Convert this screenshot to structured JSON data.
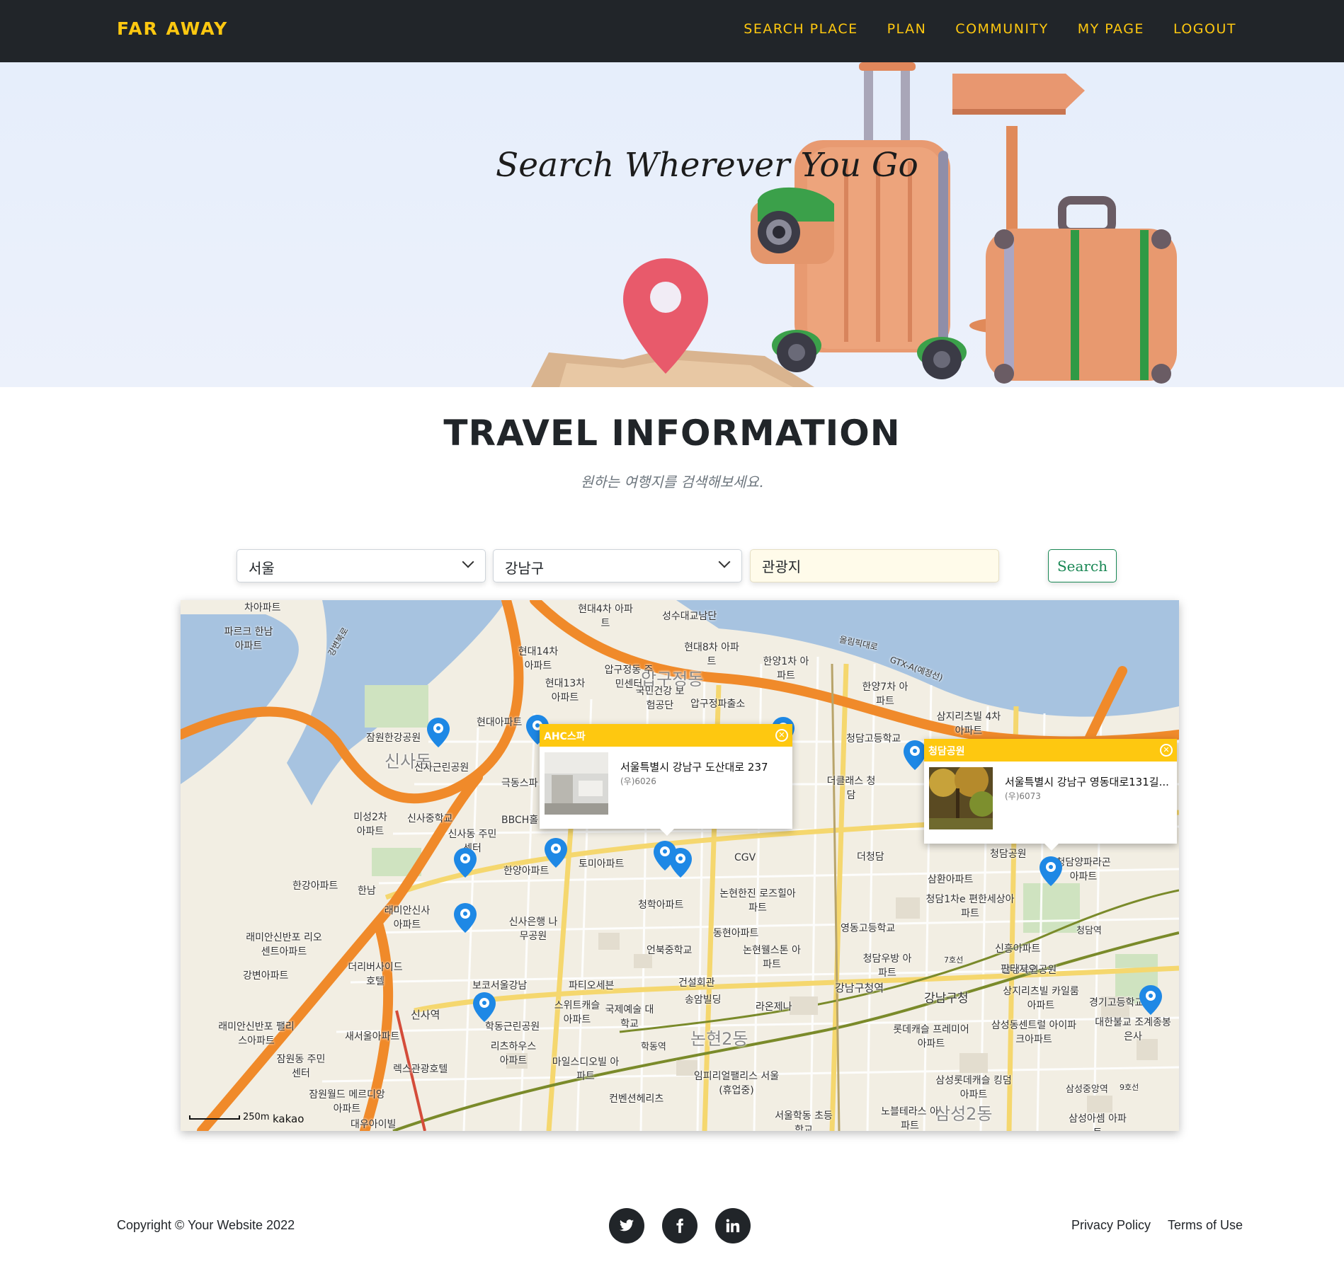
{
  "navbar": {
    "brand": "FAR AWAY",
    "links": [
      "SEARCH PLACE",
      "PLAN",
      "COMMUNITY",
      "MY PAGE",
      "LOGOUT"
    ]
  },
  "hero": {
    "title": "Search Wherever You Go"
  },
  "section": {
    "title": "TRAVEL INFORMATION",
    "subtitle": "원하는 여행지를 검색해보세요."
  },
  "search": {
    "city": "서울",
    "district": "강남구",
    "keyword": "관광지",
    "button": "Search"
  },
  "map": {
    "labels": [
      "압구정동",
      "신사동",
      "논현2동",
      "삼성2동",
      "청담공원",
      "신사역",
      "강남구청역",
      "강남구청",
      "CGV",
      "청담고등학교",
      "영동고등학교",
      "학동근린공원",
      "신사근린공원",
      "잠원한강공원",
      "한강아파트",
      "현대아파트",
      "삼성목련공원",
      "청담역",
      "삼성중앙역",
      "학동역",
      "건설회관",
      "라온제나",
      "동현아파트",
      "토미아파트",
      "한양아파트",
      "청학아파트",
      "극동스파",
      "BBCH홀",
      "현대14차 아파트",
      "현대13차 아파트",
      "압구정동 주민센터",
      "국민건강 보험공단",
      "압구정파출소",
      "한양1차 아파트",
      "한양7차 아파트",
      "삼지리츠빌 4차아파트",
      "더클래스 청담",
      "더청담",
      "삼환아파트",
      "청담1차e 편한세상아파트",
      "신흥아파트",
      "판타지오",
      "상지리츠빌 카일룸아파트",
      "경기고등학교",
      "대한불교 조계종봉은사",
      "삼성동센트럴 아이파크아파트",
      "롯데캐슬 프레미어아파트",
      "삼성롯데캐슬 킹덤아파트",
      "노블테라스 아파트",
      "삼성아셈 아파트",
      "임피리얼팰리스 서울(휴업중)",
      "컨벤션헤리츠",
      "서울학동 초등학교",
      "마일스디오빌 아파트",
      "국제예술 대학교",
      "스위트캐슬 아파트",
      "파티오세븐",
      "보코서울강남",
      "리츠하우스 아파트",
      "렉스관광호텔",
      "잠원동 주민센터",
      "잠원월드 메르디앙아파트",
      "대우아이빌",
      "새서울아파트",
      "래미안신반포 팰리스아파트",
      "강변아파트",
      "더리버사이드 호텔",
      "래미안신반포 리오센트아파트",
      "래미안신사 아파트",
      "미성2차 아파트",
      "신사중학교",
      "신사동 주민센터",
      "신사은행 나무공원",
      "한남",
      "논현한진 로즈힐아파트",
      "논현웰스톤 아파트",
      "언북중학교",
      "송암빌딩",
      "청담우방 아파트",
      "파르크 한남아파트",
      "차아파트",
      "현대4차 아파트",
      "현대8차 아파트",
      "성수대교남단",
      "올림픽대로",
      "강변북로",
      "GTX-A(예정선)",
      "청담양파라곤 아파트",
      "7호선",
      "9호선"
    ],
    "scale": "250m",
    "provider": "kakao",
    "popups": [
      {
        "name": "AHC스파",
        "address": "서울특별시 강남구 도산대로 237",
        "zip": "(우)6026"
      },
      {
        "name": "청담공원",
        "address": "서울특별시 강남구 영동대로131길...",
        "zip": "(우)6073"
      }
    ]
  },
  "footer": {
    "copyright": "Copyright © Your Website 2022",
    "social": [
      "twitter-icon",
      "facebook-icon",
      "linkedin-icon"
    ],
    "links": [
      "Privacy Policy",
      "Terms of Use"
    ]
  },
  "colors": {
    "brand": "#fec810",
    "navbar": "#212529",
    "search_button": "#198754",
    "map_pin": "#1e88e5",
    "river": "#a7c3e0"
  }
}
